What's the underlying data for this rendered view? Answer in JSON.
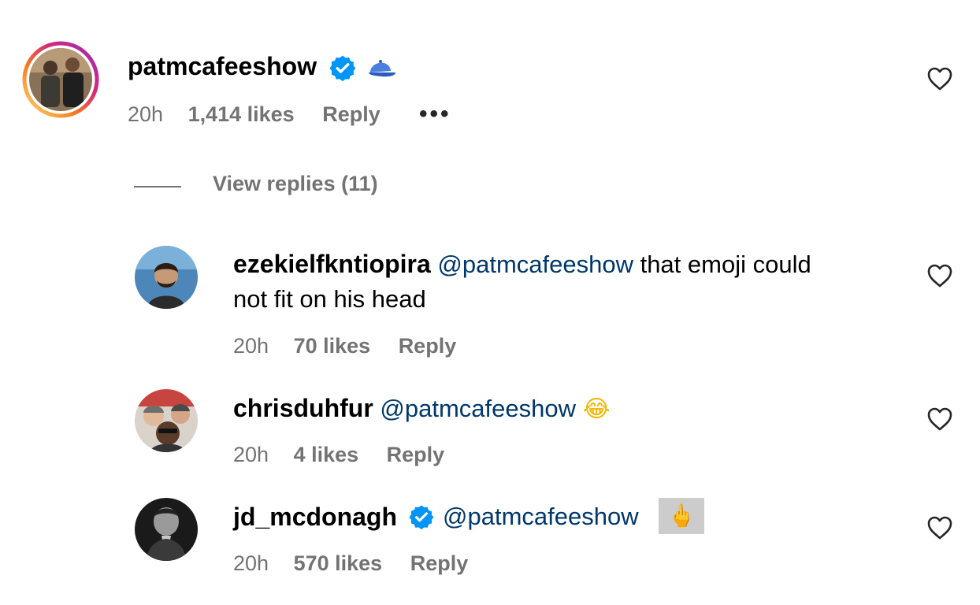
{
  "comments": [
    {
      "username": "patmcafeeshow",
      "verified": true,
      "badge_icon": "blue-cap-icon",
      "time": "20h",
      "likes": "1,414 likes",
      "reply": "Reply",
      "more_icon": "•••",
      "view_replies": "View replies (11)"
    },
    {
      "username": "ezekielfkntiopira",
      "mention": "@patmcafeeshow",
      "text_line1": " that emoji could",
      "text_line2": "not fit on his head",
      "time": "20h",
      "likes": "70 likes",
      "reply": "Reply"
    },
    {
      "username": "chrisduhfur",
      "mention": "@patmcafeeshow",
      "emoji": "😂",
      "time": "20h",
      "likes": "4 likes",
      "reply": "Reply"
    },
    {
      "username": "jd_mcdonagh",
      "verified": true,
      "mention": "@patmcafeeshow",
      "emoji": "🖕",
      "time": "20h",
      "likes": "570 likes",
      "reply": "Reply"
    }
  ],
  "colors": {
    "verified_blue": "#0095f6",
    "mention_blue": "#00376b",
    "meta_gray": "#737373"
  }
}
